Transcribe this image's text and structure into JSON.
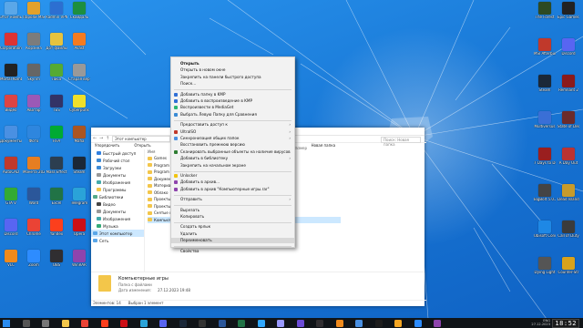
{
  "desktop": {
    "icons_left": [
      {
        "label": "Этот компьютер",
        "color": "#5aa7e8"
      },
      {
        "label": "Пароли Макан",
        "color": "#e2a12b"
      },
      {
        "label": "Radmin VPN",
        "color": "#2c6fd1"
      },
      {
        "label": "Скайдаль",
        "color": "#1d8f3f"
      },
      {
        "label": "Corporation",
        "color": "#d33"
      },
      {
        "label": "Корзина",
        "color": "#7c7c7c"
      },
      {
        "label": "Дот файлы",
        "color": "#e6c33e"
      },
      {
        "label": "Avast",
        "color": "#f47b20"
      },
      {
        "label": "Mortal Kombat",
        "color": "#222"
      },
      {
        "label": "Skyrim",
        "color": "#666"
      },
      {
        "label": "Лиса",
        "color": "#5a3"
      },
      {
        "label": "Старая версия",
        "color": "#999"
      },
      {
        "label": "Видео",
        "color": "#d44"
      },
      {
        "label": "Аватар",
        "color": "#9b59b6"
      },
      {
        "label": "TES",
        "color": "#336"
      },
      {
        "label": "Cyberpunk",
        "color": "#f0e02a"
      },
      {
        "label": "Документы",
        "color": "#4a90e2"
      },
      {
        "label": "Фото",
        "color": "#2e86de"
      },
      {
        "label": "FIFA",
        "color": "#0a3"
      },
      {
        "label": "Mafia",
        "color": "#a52"
      },
      {
        "label": "AutoCAD",
        "color": "#c0392b"
      },
      {
        "label": "Монета 2022",
        "color": "#e67e22"
      },
      {
        "label": "Mass Effect",
        "color": "#2c3e50"
      },
      {
        "label": "Steam",
        "color": "#1b2838"
      },
      {
        "label": "GTA V",
        "color": "#3a3"
      },
      {
        "label": "Word",
        "color": "#2b579a"
      },
      {
        "label": "Excel",
        "color": "#217346"
      },
      {
        "label": "Telegram",
        "color": "#2aa3d8"
      },
      {
        "label": "Discord",
        "color": "#5865f2"
      },
      {
        "label": "Chrome",
        "color": "#ea4335"
      },
      {
        "label": "Yandex",
        "color": "#fc3f1d"
      },
      {
        "label": "Opera",
        "color": "#cc0f16"
      },
      {
        "label": "VLC",
        "color": "#f08a1c"
      },
      {
        "label": "Zoom",
        "color": "#2d8cff"
      },
      {
        "label": "OBS",
        "color": "#302e31"
      },
      {
        "label": "WinRAR",
        "color": "#8e44ad"
      }
    ],
    "icons_right": [
      {
        "label": "The Forest",
        "color": "#2d4a22"
      },
      {
        "label": "Epic Games Launcher",
        "color": "#222"
      },
      {
        "label": "MSI Afterburner",
        "color": "#c0392b"
      },
      {
        "label": "Discord",
        "color": "#5865f2"
      },
      {
        "label": "Steam",
        "color": "#1b2838"
      },
      {
        "label": "Remnant 2",
        "color": "#8b1a1a"
      },
      {
        "label": "Multiversus",
        "color": "#3a6fd6"
      },
      {
        "label": "State of Decay 2",
        "color": "#6b2b2b"
      },
      {
        "label": "7 Days to Die",
        "color": "#9a1f1f"
      },
      {
        "label": "A Day Out",
        "color": "#b33"
      },
      {
        "label": "BigBolt 5.0.2",
        "color": "#444"
      },
      {
        "label": "Dead Island 2",
        "color": "#c89b2a"
      },
      {
        "label": "Ubisoft Connect",
        "color": "#1e88e5"
      },
      {
        "label": "Call of Duty",
        "color": "#3b3b3b"
      },
      {
        "label": "Dying Light",
        "color": "#555"
      },
      {
        "label": "Counter-Str",
        "color": "#d9a21b"
      }
    ]
  },
  "explorer": {
    "address": "Этот компьютер",
    "search_placeholder": "Поиск: Новая папка",
    "commands": [
      "Упорядочить",
      "Открыть",
      "Новая папка"
    ],
    "header_name": "Имя",
    "right_header": "Размер",
    "nav": [
      {
        "label": "Быстрый доступ",
        "color": "#2f7fe0"
      },
      {
        "label": "Рабочий стол",
        "color": "#3c8ad6"
      },
      {
        "label": "Загрузки",
        "color": "#3c8ad6"
      },
      {
        "label": "Документы",
        "color": "#999"
      },
      {
        "label": "Изображения",
        "color": "#4aa"
      },
      {
        "label": "Программы",
        "color": "#f3c64a"
      },
      {
        "label": "Библиотеки",
        "color": "#5a8"
      },
      {
        "label": "Видео",
        "color": "#444"
      },
      {
        "label": "Документы",
        "color": "#999"
      },
      {
        "label": "Изображения",
        "color": "#4aa"
      },
      {
        "label": "Музыка",
        "color": "#3a7"
      },
      {
        "label": "Этот компьютер",
        "color": "#5aa7e8"
      },
      {
        "label": "Сеть",
        "color": "#5aa7e8"
      }
    ],
    "files": [
      "Games",
      "Program",
      "Program Fi",
      "Документы",
      "Материал д",
      "Облако",
      "Проекты",
      "Проекты 1",
      "Снятые ф",
      "Компьютерные игры"
    ],
    "details": {
      "name": "Компьютерные игры",
      "type": "Папка с файлами",
      "date_label": "Дата изменения:",
      "date_value": "27.12.2023 19:48"
    },
    "status": {
      "count": "Элементов: 14",
      "selected": "Выбран 1 элемент"
    }
  },
  "context_menu": {
    "items": [
      {
        "label": "Открыть",
        "bold": true,
        "icon": "",
        "arrow": false
      },
      {
        "label": "Открыть в новом окне",
        "icon": "",
        "arrow": false
      },
      {
        "label": "Закрепить на панели быстрого доступа",
        "icon": "",
        "arrow": false
      },
      {
        "label": "Поиск...",
        "icon": "",
        "arrow": false
      },
      {
        "label": "Добавить папку в KMP",
        "icon": "#2f6fd6",
        "arrow": false
      },
      {
        "label": "Добавить в воспроизведение в KMP",
        "icon": "#2f6fd6",
        "arrow": false
      },
      {
        "label": "Воспроизвести в MediaGet",
        "icon": "#2bb673",
        "arrow": false
      },
      {
        "label": "Выбрать Левую Папку для Сравнения",
        "icon": "#3a8bd5",
        "arrow": false
      },
      {
        "label": "Предоставить доступ к",
        "icon": "",
        "arrow": true
      },
      {
        "label": "UltraISO",
        "icon": "#c0392b",
        "arrow": true
      },
      {
        "label": "Синхронизация общих папок",
        "icon": "#4a90e2",
        "arrow": true
      },
      {
        "label": "Восстановить прежнюю версию",
        "icon": "",
        "arrow": false
      },
      {
        "label": "Сканировать выбранные объекты на наличие вирусов",
        "icon": "#2e7d32",
        "arrow": false
      },
      {
        "label": "Добавить в библиотеку",
        "icon": "",
        "arrow": true
      },
      {
        "label": "Закрепить на начальном экране",
        "icon": "",
        "arrow": false
      },
      {
        "label": "Unlocker",
        "icon": "#f1c40f",
        "arrow": false
      },
      {
        "label": "Добавить в архив...",
        "icon": "#8e44ad",
        "arrow": false
      },
      {
        "label": "Добавить в архив \"Компьютерные игры.rar\"",
        "icon": "#8e44ad",
        "arrow": false
      },
      {
        "label": "Отправить",
        "icon": "",
        "arrow": true
      },
      {
        "label": "Вырезать",
        "icon": "",
        "arrow": false
      },
      {
        "label": "Копировать",
        "icon": "",
        "arrow": false
      },
      {
        "label": "Создать ярлык",
        "icon": "",
        "arrow": false
      },
      {
        "label": "Удалить",
        "icon": "",
        "arrow": false
      },
      {
        "label": "Переименовать",
        "icon": "",
        "arrow": false,
        "highlight": true
      },
      {
        "label": "Свойства",
        "icon": "",
        "arrow": false
      }
    ]
  },
  "taskbar": {
    "apps": [
      {
        "name": "start",
        "color": "#2a8cf0"
      },
      {
        "name": "search",
        "color": "#555"
      },
      {
        "name": "task-view",
        "color": "#777"
      },
      {
        "name": "explorer",
        "color": "#f3c64a"
      },
      {
        "name": "chrome",
        "color": "#ea4335"
      },
      {
        "name": "yandex",
        "color": "#fc3f1d"
      },
      {
        "name": "opera",
        "color": "#cc0f16"
      },
      {
        "name": "telegram",
        "color": "#2aa3d8"
      },
      {
        "name": "discord",
        "color": "#5865f2"
      },
      {
        "name": "steam",
        "color": "#1b2838"
      },
      {
        "name": "epic",
        "color": "#333"
      },
      {
        "name": "word",
        "color": "#2b579a"
      },
      {
        "name": "excel",
        "color": "#217346"
      },
      {
        "name": "photoshop",
        "color": "#31a8ff"
      },
      {
        "name": "premiere",
        "color": "#9999ff"
      },
      {
        "name": "after-effects",
        "color": "#6b4bd6"
      },
      {
        "name": "obs",
        "color": "#302e31"
      },
      {
        "name": "vlc",
        "color": "#f08a1c"
      },
      {
        "name": "notepad",
        "color": "#4a90e2"
      },
      {
        "name": "vegas",
        "color": "#1d1d1d"
      },
      {
        "name": "audacity",
        "color": "#f5a623"
      },
      {
        "name": "zoom",
        "color": "#2d8cff"
      },
      {
        "name": "winrar",
        "color": "#8e44ad"
      }
    ],
    "tray_lang": "ENG",
    "tray_date": "27.12.2023",
    "clock": "18:52"
  }
}
